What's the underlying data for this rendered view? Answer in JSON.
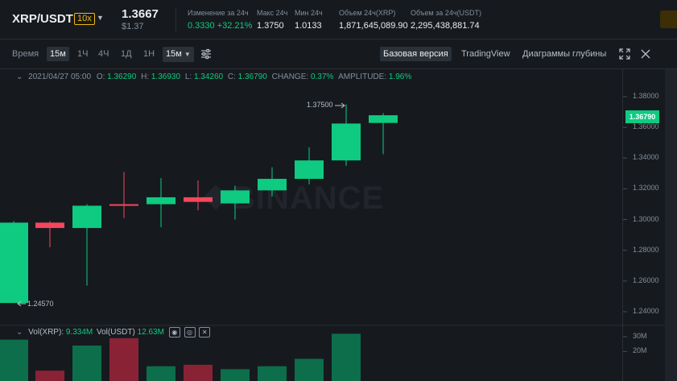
{
  "header": {
    "pair": "XRP/USDT",
    "leverage": "10x",
    "last_price": "1.3667",
    "last_price_usd": "$1.37",
    "stats": [
      {
        "label": "Изменение за 24ч",
        "value": "0.3330 +32.21%"
      },
      {
        "label": "Макс 24ч",
        "value": "1.3750"
      },
      {
        "label": "Мин 24ч",
        "value": "1.0133"
      },
      {
        "label": "Объем 24ч(XRP)",
        "value": "1,871,645,089.90"
      },
      {
        "label": "Объем за 24ч(USDT)",
        "value": "2,295,438,881.74"
      }
    ]
  },
  "toolbar": {
    "intervals": [
      "Время",
      "15м",
      "1Ч",
      "4Ч",
      "1Д",
      "1Н",
      "15м"
    ],
    "views": [
      "Базовая версия",
      "TradingView",
      "Диаграммы глубины"
    ],
    "expand_icon": "expand-icon",
    "close_icon": "close-icon",
    "settings_icon": "settings-sliders-icon"
  },
  "ohlc": {
    "datetime": "2021/04/27 05:00",
    "o_label": "O:",
    "o": "1.36290",
    "h_label": "H:",
    "h": "1.36930",
    "l_label": "L:",
    "l": "1.34260",
    "c_label": "C:",
    "c": "1.36790",
    "change_label": "CHANGE:",
    "change": "0.37%",
    "amplitude_label": "AMPLITUDE:",
    "amplitude": "1.96%"
  },
  "volume": {
    "xrp_label": "Vol(XRP):",
    "xrp": "9.334M",
    "usdt_label": "Vol(USDT)",
    "usdt": "12.63M"
  },
  "chart_data": {
    "type": "candlestick",
    "watermark": "BINANCE",
    "ylim": [
      1.23,
      1.39
    ],
    "y_ticks": [
      "1.38000",
      "1.36000",
      "1.34000",
      "1.32000",
      "1.30000",
      "1.28000",
      "1.26000",
      "1.24000"
    ],
    "y_tick_values": [
      1.38,
      1.36,
      1.34,
      1.32,
      1.3,
      1.28,
      1.26,
      1.24
    ],
    "last_price_label": "1.36790",
    "last_price": 1.3679,
    "high_marker": "1.37500",
    "low_marker": "1.24570",
    "candles": [
      {
        "o": 1.2457,
        "h": 1.299,
        "l": 1.2457,
        "c": 1.298
      },
      {
        "o": 1.298,
        "h": 1.299,
        "l": 1.282,
        "c": 1.2945
      },
      {
        "o": 1.2945,
        "h": 1.31,
        "l": 1.257,
        "c": 1.309
      },
      {
        "o": 1.31,
        "h": 1.331,
        "l": 1.301,
        "c": 1.3095
      },
      {
        "o": 1.31,
        "h": 1.327,
        "l": 1.295,
        "c": 1.3145
      },
      {
        "o": 1.3145,
        "h": 1.3255,
        "l": 1.306,
        "c": 1.3115
      },
      {
        "o": 1.3105,
        "h": 1.322,
        "l": 1.3,
        "c": 1.319
      },
      {
        "o": 1.319,
        "h": 1.334,
        "l": 1.315,
        "c": 1.3265
      },
      {
        "o": 1.3265,
        "h": 1.347,
        "l": 1.323,
        "c": 1.3385
      },
      {
        "o": 1.3385,
        "h": 1.375,
        "l": 1.335,
        "c": 1.3625
      },
      {
        "o": 1.3629,
        "h": 1.3693,
        "l": 1.3426,
        "c": 1.3679
      }
    ],
    "volume_ylim": [
      0,
      36
    ],
    "volume_ticks": [
      "30M",
      "20M"
    ],
    "volume_tick_values": [
      30,
      20
    ],
    "volumes": [
      {
        "v": 28,
        "up": true
      },
      {
        "v": 7,
        "up": false
      },
      {
        "v": 24,
        "up": true
      },
      {
        "v": 29,
        "up": false
      },
      {
        "v": 10,
        "up": true
      },
      {
        "v": 11,
        "up": false
      },
      {
        "v": 8,
        "up": true
      },
      {
        "v": 10,
        "up": true
      },
      {
        "v": 15,
        "up": true
      },
      {
        "v": 32,
        "up": true
      }
    ],
    "colors": {
      "up": "#0ecb81",
      "down": "#f6465d",
      "vol_up": "#0c6e4b",
      "vol_down": "#8a2236"
    }
  }
}
